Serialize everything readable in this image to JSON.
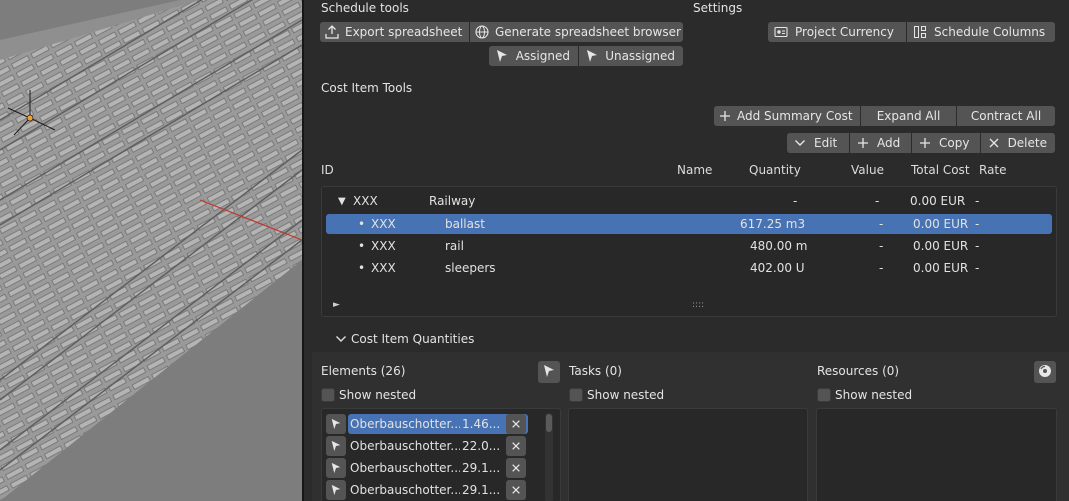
{
  "schedule_tools": {
    "heading": "Schedule tools",
    "export_label": "Export spreadsheet",
    "generate_label": "Generate spreadsheet browser",
    "assigned_label": "Assigned",
    "unassigned_label": "Unassigned"
  },
  "settings": {
    "heading": "Settings",
    "currency_label": "Project Currency",
    "columns_label": "Schedule Columns"
  },
  "cost_item_tools": {
    "heading": "Cost Item Tools",
    "add_summary_label": "Add Summary Cost",
    "expand_all_label": "Expand All",
    "contract_all_label": "Contract All",
    "edit_label": "Edit",
    "add_label": "Add",
    "copy_label": "Copy",
    "delete_label": "Delete"
  },
  "columns": {
    "id": "ID",
    "name": "Name",
    "quantity": "Quantity",
    "value": "Value",
    "total_cost": "Total Cost",
    "rate": "Rate"
  },
  "cost_items": [
    {
      "id": "XXX",
      "name": "Railway",
      "quantity": "-",
      "value": "-",
      "total": "0.00 EUR",
      "rate": "-",
      "marker": "▼"
    },
    {
      "id": "XXX",
      "name": "ballast",
      "quantity": "617.25 m3",
      "value": "-",
      "total": "0.00 EUR",
      "rate": "-",
      "marker": "•"
    },
    {
      "id": "XXX",
      "name": "rail",
      "quantity": "480.00 m",
      "value": "-",
      "total": "0.00 EUR",
      "rate": "-",
      "marker": "•"
    },
    {
      "id": "XXX",
      "name": "sleepers",
      "quantity": "402.00 U",
      "value": "-",
      "total": "0.00 EUR",
      "rate": "-",
      "marker": "•"
    }
  ],
  "tree_footer": {
    "expand_marker": "►",
    "grip": "::::"
  },
  "quantities": {
    "heading": "Cost Item Quantities",
    "elements_label": "Elements (26)",
    "tasks_label": "Tasks (0)",
    "resources_label": "Resources (0)",
    "show_nested": "Show nested",
    "elements": [
      {
        "name": "Oberbauschotter...",
        "qty": "1.46..."
      },
      {
        "name": "Oberbauschotter...",
        "qty": "22.0..."
      },
      {
        "name": "Oberbauschotter...",
        "qty": "29.1..."
      },
      {
        "name": "Oberbauschotter...",
        "qty": "29.1..."
      }
    ]
  },
  "colors": {
    "selection": "#4772b3",
    "button": "#545454",
    "panel": "#2b2b2b"
  }
}
